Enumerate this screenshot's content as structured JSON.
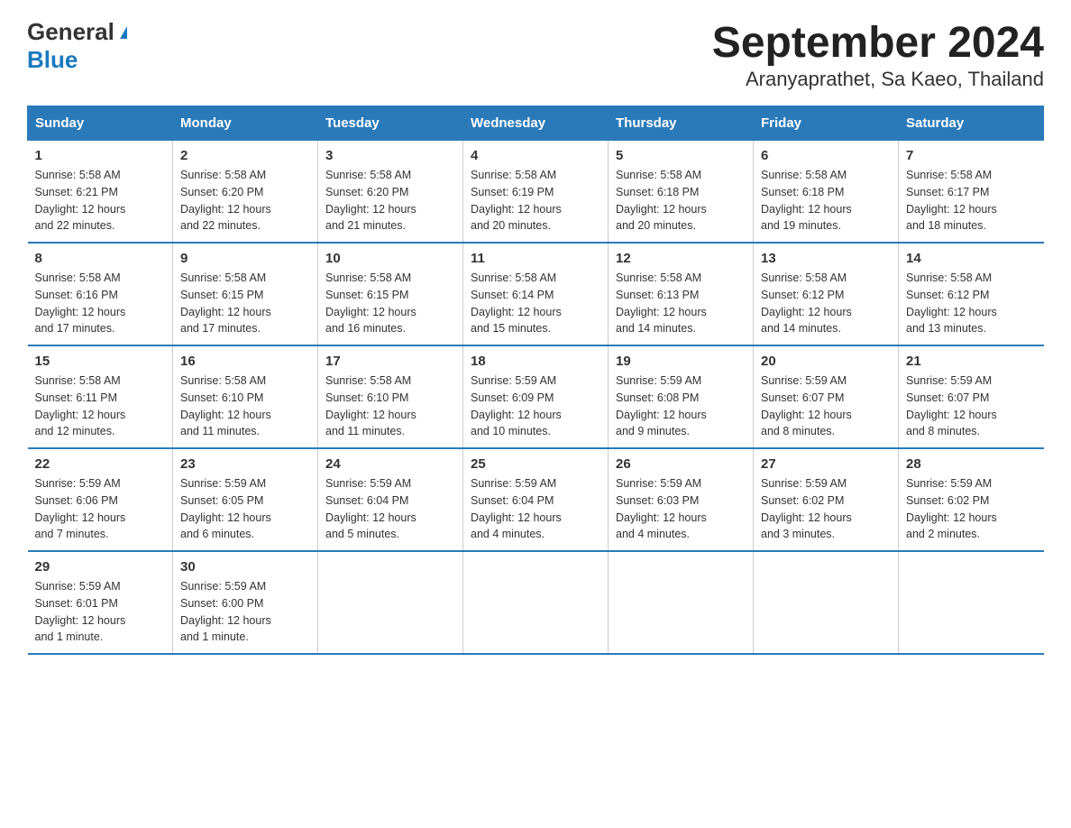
{
  "logo": {
    "general": "General",
    "blue": "Blue"
  },
  "title": "September 2024",
  "subtitle": "Aranyaprathet, Sa Kaeo, Thailand",
  "days_of_week": [
    "Sunday",
    "Monday",
    "Tuesday",
    "Wednesday",
    "Thursday",
    "Friday",
    "Saturday"
  ],
  "weeks": [
    [
      {
        "day": "1",
        "sunrise": "5:58 AM",
        "sunset": "6:21 PM",
        "daylight": "12 hours and 22 minutes."
      },
      {
        "day": "2",
        "sunrise": "5:58 AM",
        "sunset": "6:20 PM",
        "daylight": "12 hours and 22 minutes."
      },
      {
        "day": "3",
        "sunrise": "5:58 AM",
        "sunset": "6:20 PM",
        "daylight": "12 hours and 21 minutes."
      },
      {
        "day": "4",
        "sunrise": "5:58 AM",
        "sunset": "6:19 PM",
        "daylight": "12 hours and 20 minutes."
      },
      {
        "day": "5",
        "sunrise": "5:58 AM",
        "sunset": "6:18 PM",
        "daylight": "12 hours and 20 minutes."
      },
      {
        "day": "6",
        "sunrise": "5:58 AM",
        "sunset": "6:18 PM",
        "daylight": "12 hours and 19 minutes."
      },
      {
        "day": "7",
        "sunrise": "5:58 AM",
        "sunset": "6:17 PM",
        "daylight": "12 hours and 18 minutes."
      }
    ],
    [
      {
        "day": "8",
        "sunrise": "5:58 AM",
        "sunset": "6:16 PM",
        "daylight": "12 hours and 17 minutes."
      },
      {
        "day": "9",
        "sunrise": "5:58 AM",
        "sunset": "6:15 PM",
        "daylight": "12 hours and 17 minutes."
      },
      {
        "day": "10",
        "sunrise": "5:58 AM",
        "sunset": "6:15 PM",
        "daylight": "12 hours and 16 minutes."
      },
      {
        "day": "11",
        "sunrise": "5:58 AM",
        "sunset": "6:14 PM",
        "daylight": "12 hours and 15 minutes."
      },
      {
        "day": "12",
        "sunrise": "5:58 AM",
        "sunset": "6:13 PM",
        "daylight": "12 hours and 14 minutes."
      },
      {
        "day": "13",
        "sunrise": "5:58 AM",
        "sunset": "6:12 PM",
        "daylight": "12 hours and 14 minutes."
      },
      {
        "day": "14",
        "sunrise": "5:58 AM",
        "sunset": "6:12 PM",
        "daylight": "12 hours and 13 minutes."
      }
    ],
    [
      {
        "day": "15",
        "sunrise": "5:58 AM",
        "sunset": "6:11 PM",
        "daylight": "12 hours and 12 minutes."
      },
      {
        "day": "16",
        "sunrise": "5:58 AM",
        "sunset": "6:10 PM",
        "daylight": "12 hours and 11 minutes."
      },
      {
        "day": "17",
        "sunrise": "5:58 AM",
        "sunset": "6:10 PM",
        "daylight": "12 hours and 11 minutes."
      },
      {
        "day": "18",
        "sunrise": "5:59 AM",
        "sunset": "6:09 PM",
        "daylight": "12 hours and 10 minutes."
      },
      {
        "day": "19",
        "sunrise": "5:59 AM",
        "sunset": "6:08 PM",
        "daylight": "12 hours and 9 minutes."
      },
      {
        "day": "20",
        "sunrise": "5:59 AM",
        "sunset": "6:07 PM",
        "daylight": "12 hours and 8 minutes."
      },
      {
        "day": "21",
        "sunrise": "5:59 AM",
        "sunset": "6:07 PM",
        "daylight": "12 hours and 8 minutes."
      }
    ],
    [
      {
        "day": "22",
        "sunrise": "5:59 AM",
        "sunset": "6:06 PM",
        "daylight": "12 hours and 7 minutes."
      },
      {
        "day": "23",
        "sunrise": "5:59 AM",
        "sunset": "6:05 PM",
        "daylight": "12 hours and 6 minutes."
      },
      {
        "day": "24",
        "sunrise": "5:59 AM",
        "sunset": "6:04 PM",
        "daylight": "12 hours and 5 minutes."
      },
      {
        "day": "25",
        "sunrise": "5:59 AM",
        "sunset": "6:04 PM",
        "daylight": "12 hours and 4 minutes."
      },
      {
        "day": "26",
        "sunrise": "5:59 AM",
        "sunset": "6:03 PM",
        "daylight": "12 hours and 4 minutes."
      },
      {
        "day": "27",
        "sunrise": "5:59 AM",
        "sunset": "6:02 PM",
        "daylight": "12 hours and 3 minutes."
      },
      {
        "day": "28",
        "sunrise": "5:59 AM",
        "sunset": "6:02 PM",
        "daylight": "12 hours and 2 minutes."
      }
    ],
    [
      {
        "day": "29",
        "sunrise": "5:59 AM",
        "sunset": "6:01 PM",
        "daylight": "12 hours and 1 minute."
      },
      {
        "day": "30",
        "sunrise": "5:59 AM",
        "sunset": "6:00 PM",
        "daylight": "12 hours and 1 minute."
      },
      null,
      null,
      null,
      null,
      null
    ]
  ],
  "labels": {
    "sunrise": "Sunrise:",
    "sunset": "Sunset:",
    "daylight": "Daylight:"
  }
}
